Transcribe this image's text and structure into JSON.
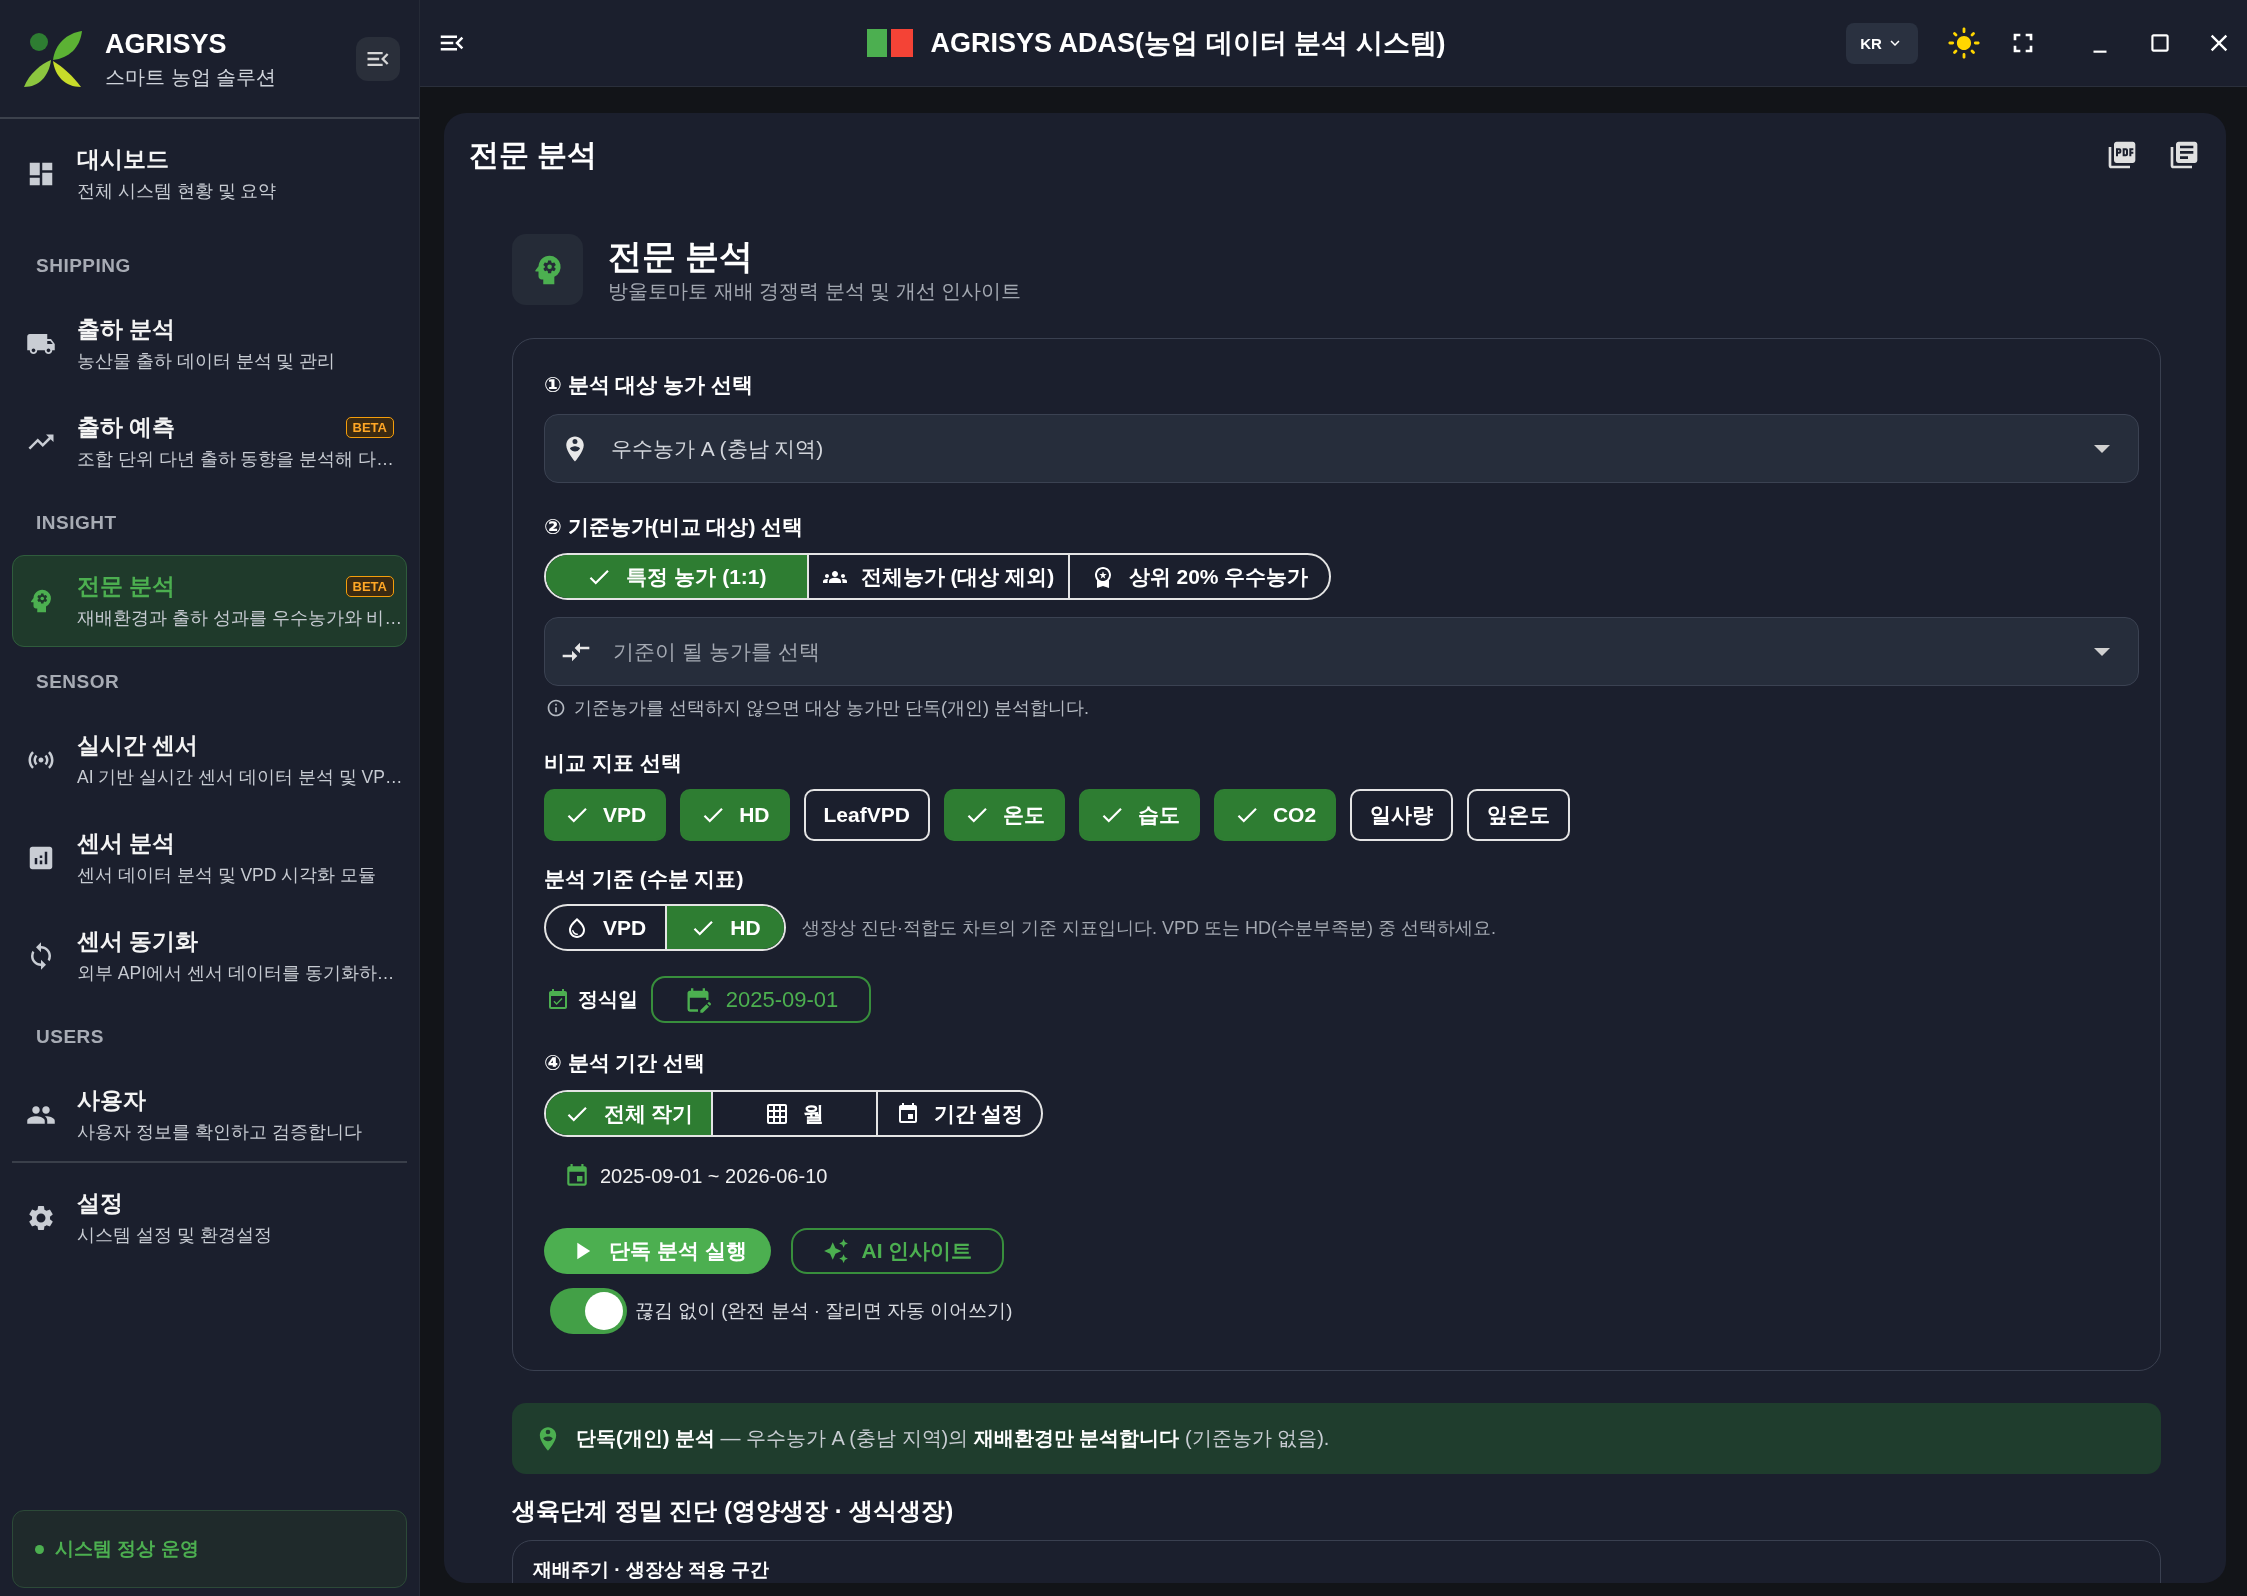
{
  "topbar": {
    "title": "AGRISYS ADAS(농업 데이터 분석 시스템)",
    "language": "KR"
  },
  "sidebar": {
    "brand": "AGRISYS",
    "tagline": "스마트 농업 솔루션",
    "groups": [
      {
        "items": [
          {
            "title": "대시보드",
            "description": "전체 시스템 현황 및 요약",
            "selected": false
          }
        ]
      },
      {
        "heading": "SHIPPING",
        "items": [
          {
            "title": "출하 분석",
            "description": "농산물 출하 데이터 분석 및 관리",
            "selected": false
          },
          {
            "title": "출하 예측",
            "description": "조합 단위 다년 출하 동향을 분석해 다…",
            "badge": "BETA",
            "selected": false
          }
        ]
      },
      {
        "heading": "INSIGHT",
        "items": [
          {
            "title": "전문 분석",
            "description": "재배환경과 출하 성과를 우수농가와 비…",
            "badge": "BETA",
            "selected": true
          }
        ]
      },
      {
        "heading": "SENSOR",
        "items": [
          {
            "title": "실시간 센서",
            "description": "AI 기반 실시간 센서 데이터 분석 및 VP…",
            "selected": false
          },
          {
            "title": "센서 분석",
            "description": "센서 데이터 분석 및 VPD 시각화 모듈",
            "selected": false
          },
          {
            "title": "센서 동기화",
            "description": "외부 API에서 센서 데이터를 동기화하…",
            "selected": false
          }
        ]
      },
      {
        "heading": "USERS",
        "items": [
          {
            "title": "사용자",
            "description": "사용자 정보를 확인하고 검증합니다",
            "selected": false
          }
        ]
      },
      {
        "items": [
          {
            "title": "설정",
            "description": "시스템 설정 및 환경설정",
            "selected": false
          }
        ]
      }
    ],
    "status": "시스템 정상 운영"
  },
  "page": {
    "title": "전문 분석"
  },
  "header": {
    "title": "전문 분석",
    "subtitle": "방울토마토 재배 경쟁력 분석 및 개선 인사이트"
  },
  "form": {
    "target": {
      "label": "① 분석 대상 농가 선택",
      "value": "우수농가 A (충남 지역)"
    },
    "baseline": {
      "label": "② 기준농가(비교 대상) 선택",
      "modes": [
        {
          "label": "특정 농가 (1:1)",
          "selected": true
        },
        {
          "label": "전체농가 (대상 제외)",
          "selected": false
        },
        {
          "label": "상위 20% 우수농가",
          "selected": false
        }
      ],
      "farm_select": {
        "placeholder": "기준이 될 농가를 선택"
      },
      "note": "기준농가를 선택하지 않으면 대상 농가만 단독(개인) 분석합니다."
    },
    "metrics": {
      "label": "비교 지표 선택",
      "items": [
        {
          "label": "VPD",
          "checked": true
        },
        {
          "label": "HD",
          "checked": true
        },
        {
          "label": "LeafVPD",
          "checked": false
        },
        {
          "label": "온도",
          "checked": true
        },
        {
          "label": "습도",
          "checked": true
        },
        {
          "label": "CO2",
          "checked": true
        },
        {
          "label": "일사량",
          "checked": false
        },
        {
          "label": "잎온도",
          "checked": false
        }
      ]
    },
    "basis": {
      "label": "분석 기준 (수분 지표)",
      "options": [
        {
          "label": "VPD",
          "selected": false
        },
        {
          "label": "HD",
          "selected": true
        }
      ],
      "hint": "생장상 진단·적합도 차트의 기준 지표입니다. VPD 또는 HD(수분부족분) 중 선택하세요."
    },
    "planting_date": {
      "label": "정식일",
      "value": "2025-09-01"
    },
    "period": {
      "label": "④ 분석 기간 선택",
      "modes": [
        {
          "label": "전체 작기",
          "selected": true
        },
        {
          "label": "월",
          "selected": false
        },
        {
          "label": "기간 설정",
          "selected": false
        }
      ],
      "range": "2025-09-01 ~ 2026-06-10"
    },
    "actions": [
      {
        "label": "단독 분석 실행",
        "kind": "primary"
      },
      {
        "label": "AI 인사이트",
        "kind": "outline"
      }
    ],
    "continuous": {
      "label": "끊김 없이 (완전 분석 · 잘리면 자동 이어쓰기)",
      "on": true
    }
  },
  "banner": {
    "text": "**단독(개인) 분석** — 우수농가 A (충남 지역)의 **재배환경만 분석합니다** (기준농가 없음)."
  },
  "diagnosis": {
    "title": "생육단계 정밀 진단 (영양생장 · 생식생장)",
    "panel_title": "재배주기 · 생장상 적용 구간"
  }
}
